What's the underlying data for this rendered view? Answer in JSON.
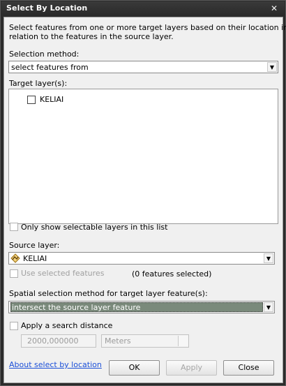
{
  "window": {
    "title": "Select By Location",
    "close_glyph": "✕"
  },
  "description": {
    "line1": "Select features from one or more target layers based on their location in",
    "line2": "relation to the features in the source layer."
  },
  "selection_method": {
    "label": "Selection method:",
    "value": "select features from"
  },
  "target_layers": {
    "label": "Target layer(s):",
    "items": [
      {
        "name": "KELIAI",
        "checked": false
      }
    ]
  },
  "only_selectable": {
    "label": "Only show selectable layers in this list",
    "checked": false
  },
  "source_layer": {
    "label": "Source layer:",
    "value": "KELIAI",
    "icon": "line-layer-icon"
  },
  "use_selected": {
    "label": "Use selected features",
    "count_text": "(0 features selected)",
    "checked": false
  },
  "spatial_method": {
    "label": "Spatial selection method for target layer feature(s):",
    "value": "intersect the source layer feature"
  },
  "search_distance": {
    "label": "Apply a search distance",
    "checked": false,
    "value": "2000,000000",
    "units": "Meters"
  },
  "footer": {
    "help_link": "About select by location",
    "ok": "OK",
    "apply": "Apply",
    "close": "Close"
  }
}
